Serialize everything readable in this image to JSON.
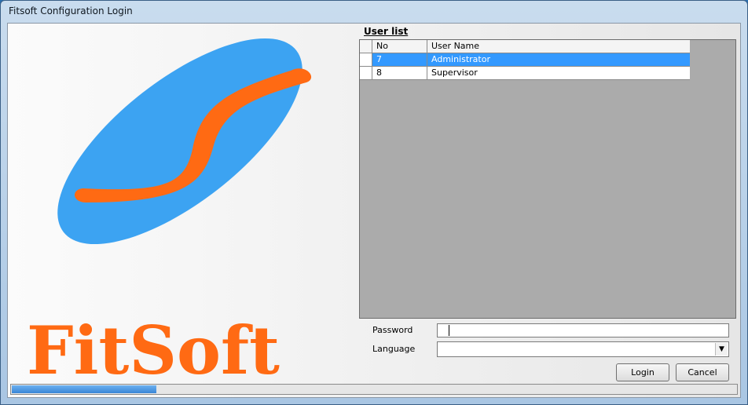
{
  "window": {
    "title": "Fitsoft Configuration Login"
  },
  "logo": {
    "text": "FitSoft",
    "colors": {
      "ellipse": "#3ca3f2",
      "swoosh": "#ff6a13",
      "text": "#ff6a13"
    }
  },
  "user_list": {
    "title": "User list",
    "columns": [
      "No",
      "User Name"
    ],
    "rows": [
      {
        "no": "7",
        "name": "Administrator",
        "selected": true
      },
      {
        "no": "8",
        "name": "Supervisor",
        "selected": false
      }
    ]
  },
  "form": {
    "password_label": "Password",
    "password_value": "",
    "language_label": "Language",
    "language_value": ""
  },
  "buttons": {
    "login": "Login",
    "cancel": "Cancel"
  },
  "progress": {
    "percent": 20
  },
  "colors": {
    "selection": "#3399ff",
    "grid_background": "#ababab"
  }
}
